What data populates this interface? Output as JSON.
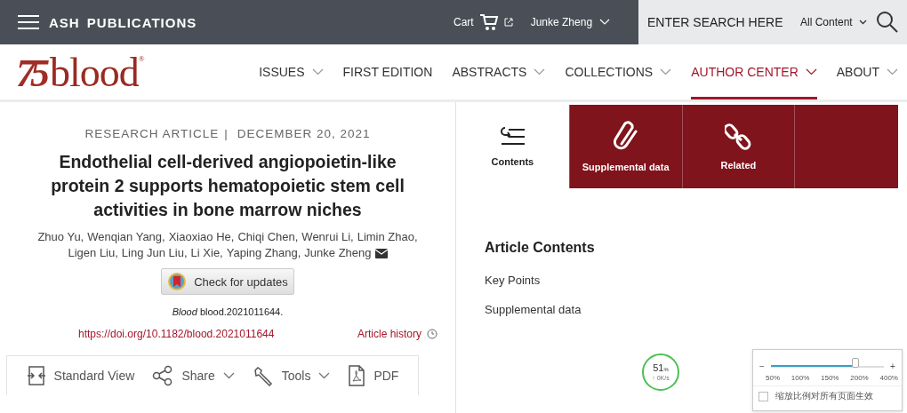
{
  "topbar": {
    "brand": "ASH PUBLICATIONS",
    "cart": "Cart",
    "user": "Junke Zheng",
    "search": {
      "placeholder": "ENTER SEARCH HERE"
    },
    "scope": "All Content"
  },
  "logo": {
    "badge": "75",
    "name": "blood",
    "mark": "®"
  },
  "nav": [
    {
      "label": "ISSUES",
      "dropdown": true,
      "selected": false
    },
    {
      "label": "FIRST EDITION",
      "dropdown": false,
      "selected": false
    },
    {
      "label": "ABSTRACTS",
      "dropdown": true,
      "selected": false
    },
    {
      "label": "COLLECTIONS",
      "dropdown": true,
      "selected": false
    },
    {
      "label": "AUTHOR CENTER",
      "dropdown": true,
      "selected": true
    },
    {
      "label": "ABOUT",
      "dropdown": true,
      "selected": false
    }
  ],
  "article": {
    "type": "RESEARCH ARTICLE",
    "date": "DECEMBER 20, 2021",
    "title": "Endothelial cell-derived angiopoietin-like protein 2 supports hematopoietic stem cell activities in bone marrow niches",
    "separator": "|",
    "authors": [
      "Zhuo Yu,",
      "Wenqian Yang,",
      "Xiaoxiao He,",
      "Chiqi Chen,",
      "Wenrui Li,",
      "Limin Zhao,",
      "Ligen Liu,",
      "Ling Jun Liu,",
      "Li Xie,",
      "Yaping Zhang,",
      "Junke Zheng"
    ],
    "updates_button": "Check for updates",
    "citation": "*Blood* blood.2021011644.",
    "doi": "https://doi.org/10.1182/blood.2021011644",
    "history": "Article history"
  },
  "toolbar": [
    {
      "kind": "view",
      "label": "Standard View",
      "dropdown": false
    },
    {
      "kind": "share",
      "label": "Share",
      "dropdown": true
    },
    {
      "kind": "tools",
      "label": "Tools",
      "dropdown": true
    },
    {
      "kind": "pdf",
      "label": "PDF",
      "dropdown": false
    }
  ],
  "side_tabs": [
    {
      "kind": "contents",
      "label": "Contents",
      "selected": true
    },
    {
      "kind": "supplemental",
      "label": "Supplemental data",
      "selected": false
    },
    {
      "kind": "related",
      "label": "Related",
      "selected": false
    },
    {
      "kind": "empty",
      "selected": false
    }
  ],
  "contents": {
    "heading": "Article Contents",
    "items": [
      "Key Points",
      "Supplemental data"
    ]
  },
  "speed_meter": {
    "percent": "51",
    "unit": "%",
    "rate": "↑ 0K/s"
  },
  "zoom_widget": {
    "minus": "−",
    "plus": "+",
    "level": 0.74,
    "ticks": [
      "50%",
      "100%",
      "150%",
      "200%",
      "400%"
    ],
    "apply_all": {
      "label": "缩放比例对所有页面生效",
      "checked": false
    }
  }
}
